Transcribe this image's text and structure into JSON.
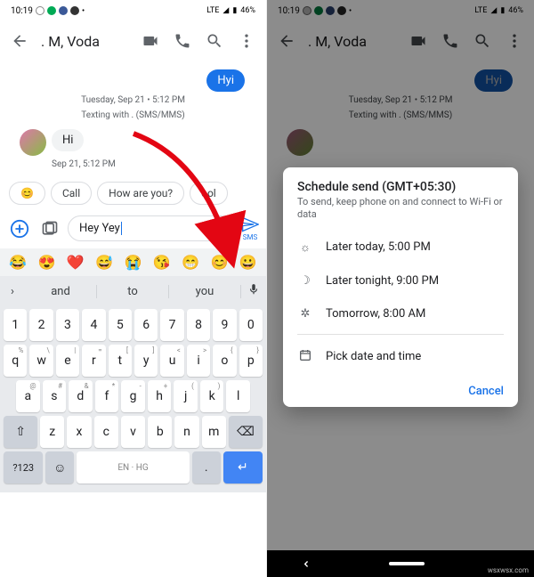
{
  "status": {
    "time": "10:19",
    "net": "LTE",
    "batt": "46%"
  },
  "appbar": {
    "title": ". M, Voda"
  },
  "conv": {
    "out1": "Hyi",
    "date": "Tuesday, Sep 21 • 5:12 PM",
    "texting": "Texting with . (SMS/MMS)",
    "in1": "Hi",
    "in1_time": "Sep 21, 5:12 PM"
  },
  "chips": {
    "c1": "😊",
    "c2": "Call",
    "c3": "How are you?",
    "c4": "ool"
  },
  "compose": {
    "text": "Hey Yey",
    "send_sub": "SMS"
  },
  "emoji_strip": [
    "😂",
    "😍",
    "❤️",
    "😅",
    "😭",
    "😘",
    "😁",
    "😊",
    "😀"
  ],
  "suggest": {
    "s1": "and",
    "s2": "to",
    "s3": "you"
  },
  "kbd": {
    "r1": [
      "1",
      "2",
      "3",
      "4",
      "5",
      "6",
      "7",
      "8",
      "9",
      "0"
    ],
    "r2": [
      [
        "q",
        "%"
      ],
      [
        "w",
        "\\"
      ],
      [
        "e",
        "|"
      ],
      [
        "r",
        "="
      ],
      [
        "t",
        "["
      ],
      [
        "y",
        "]"
      ],
      [
        "u",
        "<"
      ],
      [
        "i",
        ">"
      ],
      [
        "o",
        "{"
      ],
      [
        "p",
        "}"
      ]
    ],
    "r3": [
      [
        "a",
        "@"
      ],
      [
        "s",
        "#"
      ],
      [
        "d",
        "&"
      ],
      [
        "f",
        "*"
      ],
      [
        "g",
        "-"
      ],
      [
        "h",
        "+"
      ],
      [
        "j",
        "("
      ],
      [
        "k",
        ")"
      ],
      [
        "l",
        ""
      ]
    ],
    "r4": [
      "z",
      "x",
      "c",
      "v",
      "b",
      "n",
      "m"
    ],
    "shift": "⇧",
    "bksp": "⌫",
    "numkey": "?123",
    "lang": "EN · HG"
  },
  "dialog": {
    "title": "Schedule send (GMT+05:30)",
    "subtitle": "To send, keep phone on and connect to Wi-Fi or data",
    "opt1": "Later today, 5:00 PM",
    "opt2": "Later tonight, 9:00 PM",
    "opt3": "Tomorrow, 8:00 AM",
    "opt4": "Pick date and time",
    "cancel": "Cancel"
  },
  "watermark": "wsxwsx.com"
}
